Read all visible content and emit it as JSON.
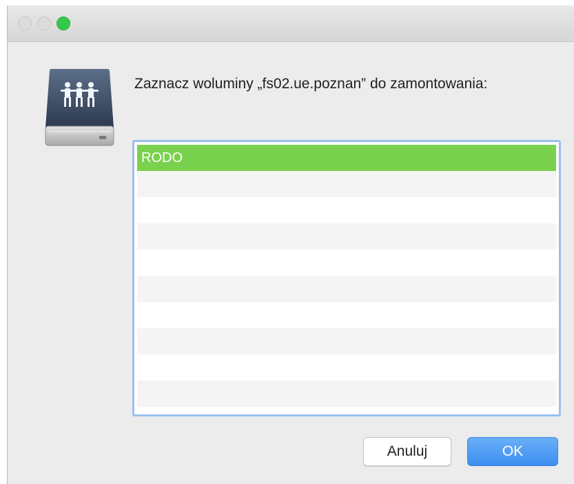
{
  "window": {
    "traffic_lights": {
      "close_color": "#dcdcdc",
      "minimize_color": "#dcdcdc",
      "zoom_color": "#35c94a"
    },
    "icon": "network-server-icon"
  },
  "dialog": {
    "message": "Zaznacz woluminy „fs02.ue.poznan” do zamontowania:",
    "volumes": [
      {
        "label": "RODO",
        "selected": true
      }
    ],
    "selection_color": "#7ad14e"
  },
  "buttons": {
    "cancel_label": "Anuluj",
    "ok_label": "OK",
    "ok_color": "#3d8ef0"
  }
}
